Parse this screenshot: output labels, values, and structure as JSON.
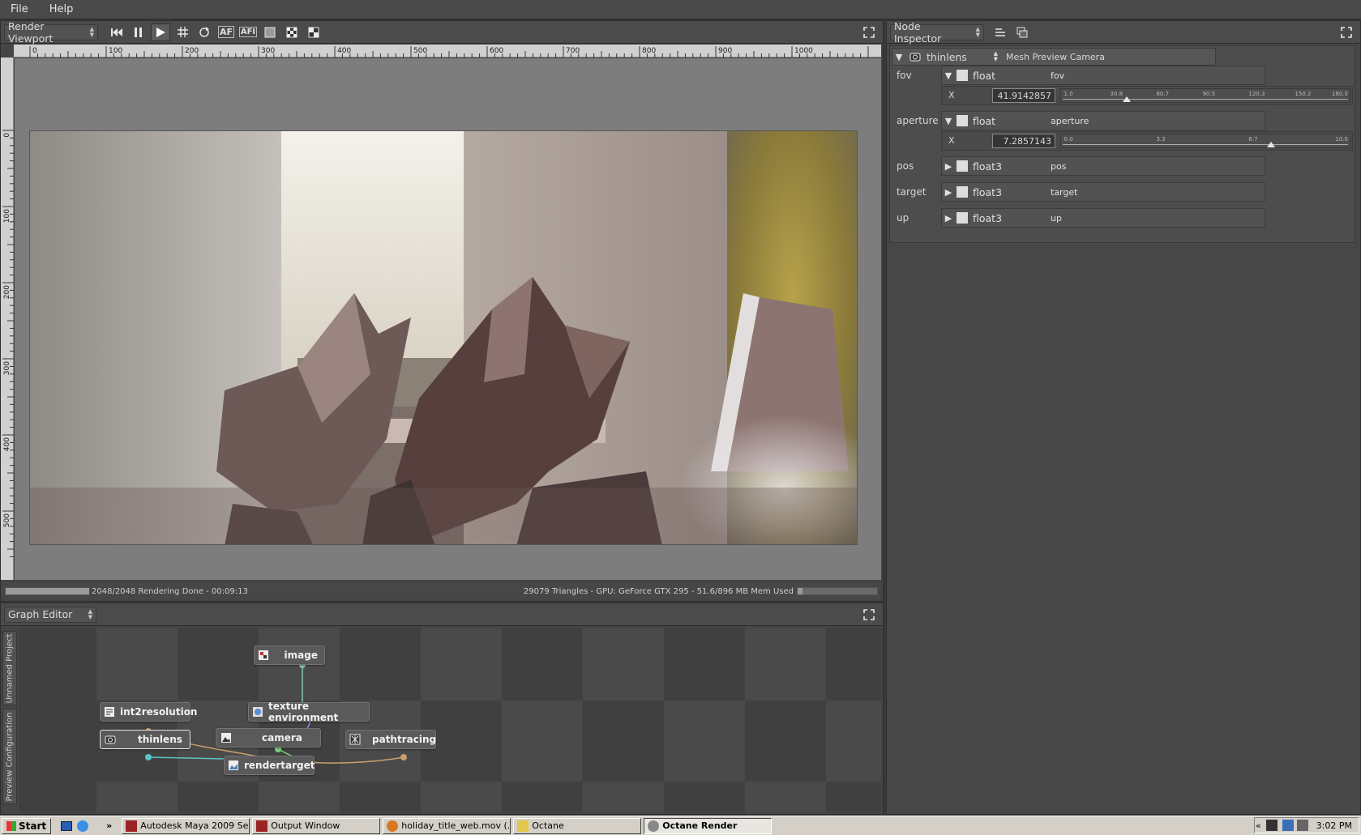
{
  "menubar": {
    "items": [
      "File",
      "Help"
    ]
  },
  "render_viewport": {
    "dropdown_label": "Render Viewport",
    "toolbar": {
      "af_label": "AF",
      "afi_label": "AFI"
    },
    "ruler_h_ticks": [
      "0",
      "100",
      "200",
      "300",
      "400",
      "500",
      "600",
      "700",
      "800",
      "900",
      "1000"
    ],
    "ruler_v_ticks": [
      "0",
      "100",
      "200",
      "300",
      "400",
      "500"
    ],
    "status": {
      "progress_fraction": 1.0,
      "left_text": "2048/2048 Rendering Done - 00:09:13",
      "right_text": "29079 Triangles - GPU: GeForce GTX 295 - 51.6/896 MB Mem Used"
    }
  },
  "graph_editor": {
    "dropdown_label": "Graph Editor",
    "side_tabs": [
      "Unnamed Project",
      "Preview Configuration"
    ],
    "nodes": [
      {
        "label": "image"
      },
      {
        "label": "int2resolution"
      },
      {
        "label": "texture environment"
      },
      {
        "label": "thinlens"
      },
      {
        "label": "camera"
      },
      {
        "label": "pathtracing"
      },
      {
        "label": "rendertarget"
      }
    ]
  },
  "node_inspector": {
    "dropdown_label": "Node Inspector",
    "node_type": "thinlens",
    "node_name": "Mesh Preview Camera",
    "params": [
      {
        "label": "fov",
        "type": "float",
        "name": "fov",
        "axis": "X",
        "value": "41.9142857",
        "ticks": [
          "1.0",
          "30.8",
          "60.7",
          "90.5",
          "120.3",
          "150.2",
          "180.0"
        ],
        "slider_min": 1.0,
        "slider_max": 180.0
      },
      {
        "label": "aperture",
        "type": "float",
        "name": "aperture",
        "axis": "X",
        "value": "7.2857143",
        "ticks": [
          "0.0",
          "3.3",
          "6.7",
          "10.0"
        ],
        "slider_min": 0.0,
        "slider_max": 10.0
      },
      {
        "label": "pos",
        "type": "float3",
        "name": "pos"
      },
      {
        "label": "target",
        "type": "float3",
        "name": "target"
      },
      {
        "label": "up",
        "type": "float3",
        "name": "up"
      }
    ]
  },
  "taskbar": {
    "start_label": "Start",
    "tasks": [
      {
        "label": "Autodesk Maya 2009 Ser..."
      },
      {
        "label": "Output Window"
      },
      {
        "label": "holiday_title_web.mov (..."
      },
      {
        "label": "Octane"
      },
      {
        "label": "Octane Render",
        "active": true
      }
    ],
    "clock": "3:02 PM"
  },
  "colors": {
    "panel_bg": "#454545",
    "viewport_bg": "#7d7d7d",
    "taskbar_bg": "#d4d0c8"
  }
}
